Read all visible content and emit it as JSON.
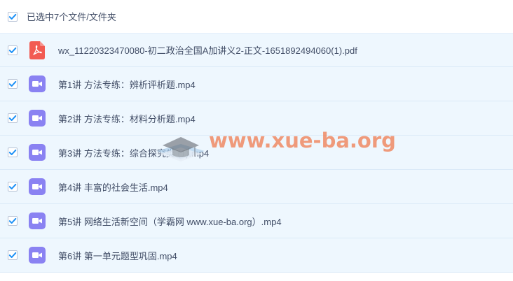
{
  "header": {
    "selection_label": "已选中7个文件/文件夹"
  },
  "colors": {
    "checkbox_check": "#1a8ff6",
    "row_bg": "#eef7fe",
    "video_icon": "#8a82f2",
    "pdf_icon": "#f25b52",
    "text": "#424e67"
  },
  "files": [
    {
      "name": "wx_11220323470080-初二政治全国A加讲义2-正文-1651892494060(1).pdf",
      "icon": "pdf-icon",
      "checked": true
    },
    {
      "name": "第1讲 方法专练：辨析评析题.mp4",
      "icon": "video-icon",
      "checked": true
    },
    {
      "name": "第2讲 方法专练：材料分析题.mp4",
      "icon": "video-icon",
      "checked": true
    },
    {
      "name": "第3讲 方法专练：综合探究类 (1).mp4",
      "icon": "video-icon",
      "checked": true
    },
    {
      "name": "第4讲 丰富的社会生活.mp4",
      "icon": "video-icon",
      "checked": true
    },
    {
      "name": "第5讲 网络生活新空间（学霸网 www.xue-ba.org）.mp4",
      "icon": "video-icon",
      "checked": true
    },
    {
      "name": "第6讲 第一单元题型巩固.mp4",
      "icon": "video-icon",
      "checked": true
    }
  ],
  "watermark": {
    "text": "www.xue-ba.org",
    "icon": "graduation-cap-book-logo"
  }
}
